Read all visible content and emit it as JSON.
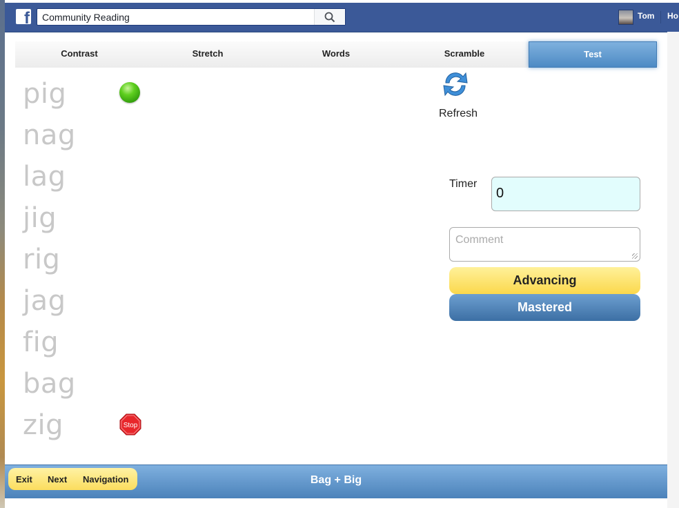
{
  "facebook": {
    "search_value": "Community Reading",
    "user_name": "Tom",
    "home_link": "Ho"
  },
  "tabs": [
    {
      "label": "Contrast",
      "active": false
    },
    {
      "label": "Stretch",
      "active": false
    },
    {
      "label": "Words",
      "active": false
    },
    {
      "label": "Scramble",
      "active": false
    },
    {
      "label": "Test",
      "active": true
    }
  ],
  "words": [
    "pig",
    "nag",
    "lag",
    "jig",
    "rig",
    "jag",
    "fig",
    "bag",
    "zig"
  ],
  "markers": {
    "start_icon": "green-circle-icon",
    "stop_icon": "stop-sign-icon",
    "stop_text": "Stop"
  },
  "refresh": {
    "label": "Refresh",
    "icon": "refresh-icon"
  },
  "timer": {
    "label": "Timer",
    "value": "0"
  },
  "comment": {
    "placeholder": "Comment"
  },
  "buttons": {
    "advancing": "Advancing",
    "mastered": "Mastered"
  },
  "bottom": {
    "nav": [
      "Exit",
      "Next",
      "Navigation"
    ],
    "title": "Bag + Big"
  },
  "colors": {
    "facebook_blue": "#3b5998",
    "active_tab": "#5b95cc",
    "advancing_yellow": "#fbd84c",
    "mastered_blue": "#3c6fa4",
    "timer_bg": "#e2fdfd",
    "word_gray": "#c8c8c8"
  }
}
